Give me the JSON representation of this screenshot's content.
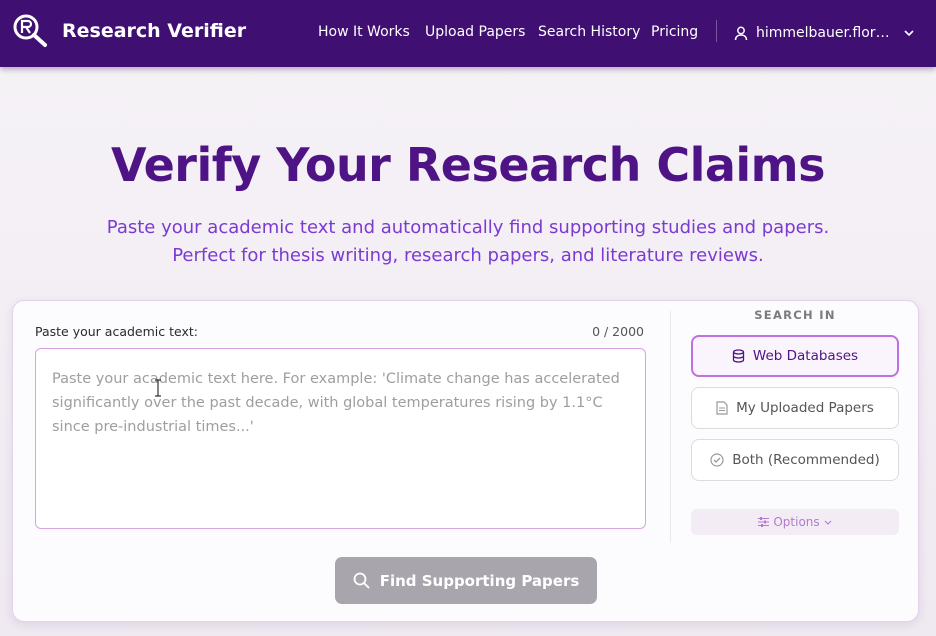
{
  "header": {
    "brand": "Research Verifier",
    "nav": [
      "How It Works",
      "Upload Papers",
      "Search History",
      "Pricing"
    ],
    "user": "himmelbauer.florian..."
  },
  "hero": {
    "title": "Verify Your Research Claims",
    "subtitle": "Paste your academic text and automatically find supporting studies and papers. Perfect for thesis writing, research papers, and literature reviews."
  },
  "input": {
    "label": "Paste your academic text:",
    "count": "0 / 2000",
    "placeholder": "Paste your academic text here. For example: 'Climate change has accelerated significantly over the past decade, with global temperatures rising by 1.1°C since pre-industrial times...'",
    "value": ""
  },
  "search_in": {
    "heading": "SEARCH IN",
    "options": [
      {
        "label": "Web Databases",
        "icon": "database-icon",
        "selected": true
      },
      {
        "label": "My Uploaded Papers",
        "icon": "document-icon",
        "selected": false
      },
      {
        "label": "Both (Recommended)",
        "icon": "check-circle-icon",
        "selected": false
      }
    ],
    "options_label": "Options"
  },
  "actions": {
    "find_label": "Find Supporting Papers"
  },
  "colors": {
    "header_bg": "#3f0f72",
    "title": "#4e1485",
    "subtitle": "#7a3bd1",
    "accent": "#c070e0",
    "button_disabled": "#a8a5ad"
  }
}
